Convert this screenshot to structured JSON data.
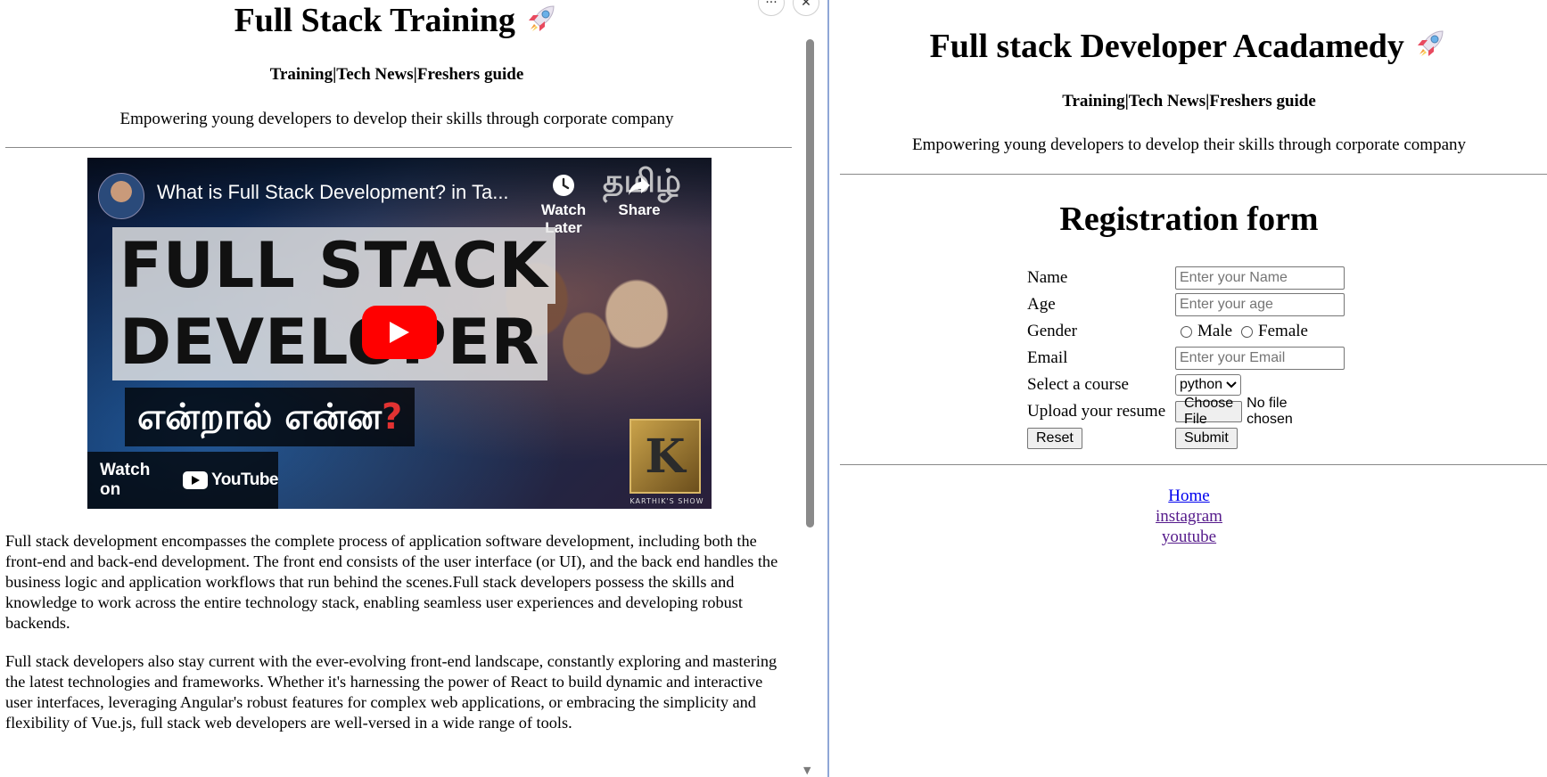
{
  "left": {
    "title": "Full Stack Training",
    "nav": "Training|Tech News|Freshers guide",
    "tagline": "Empowering young developers to develop their skills through corporate company",
    "video": {
      "title": "What is Full Stack Development? in Ta...",
      "watch_later": "Watch Later",
      "share": "Share",
      "lang_badge": "தமிழ்",
      "headline_1": "FULL STACK",
      "headline_2": "DEVELOPER",
      "headline_3": "என்றால் என்ன",
      "headline_3_mark": "?",
      "watch_on": "Watch on",
      "youtube": "YouTube",
      "channel_initial": "K",
      "channel_caption": "KARTHIK'S SHOW"
    },
    "paragraph_1": "Full stack development encompasses the complete process of application software development, including both the front-end and back-end development. The front end consists of the user interface (or UI), and the back end handles the business logic and application workflows that run behind the scenes.Full stack developers possess the skills and knowledge to work across the entire technology stack, enabling seamless user experiences and developing robust backends.",
    "paragraph_2": "Full stack developers also stay current with the ever-evolving front-end landscape, constantly exploring and mastering the latest technologies and frameworks. Whether it's harnessing the power of React to build dynamic and interactive user interfaces, leveraging Angular's robust features for complex web applications, or embracing the simplicity and flexibility of Vue.js, full stack web developers are well-versed in a wide range of tools."
  },
  "right": {
    "title": "Full stack Developer Acadamedy",
    "nav": "Training|Tech News|Freshers guide",
    "tagline": "Empowering young developers to develop their skills through corporate company",
    "form_title": "Registration form",
    "form": {
      "name_label": "Name",
      "name_placeholder": "Enter your Name",
      "age_label": "Age",
      "age_placeholder": "Enter your age",
      "gender_label": "Gender",
      "gender_male": "Male",
      "gender_female": "Female",
      "email_label": "Email",
      "email_placeholder": "Enter your Email",
      "course_label": "Select a course",
      "course_selected": "python",
      "resume_label": "Upload your resume",
      "choose_file": "Choose File",
      "no_file": "No file chosen",
      "reset": "Reset",
      "submit": "Submit"
    },
    "links": {
      "home": "Home",
      "instagram": "instagram",
      "youtube": "youtube"
    }
  },
  "controls": {
    "more": "···",
    "close": "✕"
  },
  "colors": {
    "link_unvisited": "#0000ee",
    "link_visited": "#551a8b",
    "youtube_red": "#ff0000",
    "pane_border": "#8fa7d6"
  }
}
